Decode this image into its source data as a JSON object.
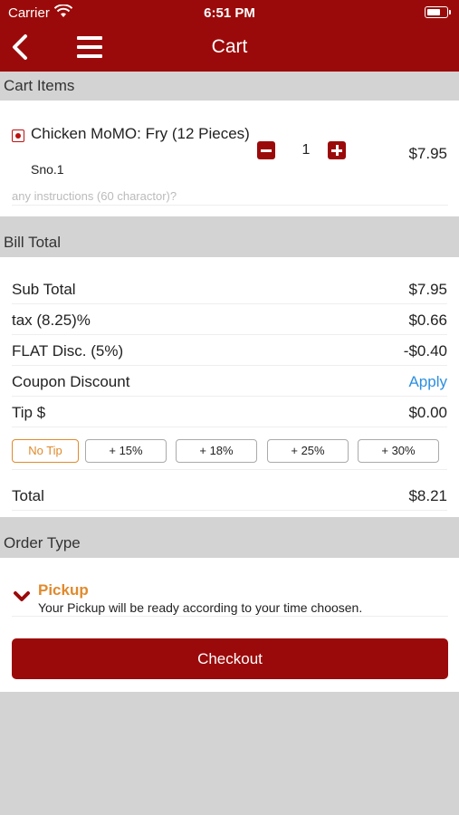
{
  "status_bar": {
    "carrier": "Carrier",
    "time": "6:51 PM"
  },
  "nav": {
    "title": "Cart"
  },
  "sections": {
    "cart_items": "Cart Items",
    "bill_total": "Bill Total",
    "order_type": "Order Type"
  },
  "cart": {
    "items": [
      {
        "name": "Chicken MoMO: Fry (12 Pieces)",
        "sno": "Sno.1",
        "quantity": "1",
        "price": "$7.95",
        "instructions_placeholder": "any instructions (60 charactor)?"
      }
    ]
  },
  "bill": {
    "sub_total_label": "Sub Total",
    "sub_total": "$7.95",
    "tax_label": "tax (8.25)%",
    "tax": "$0.66",
    "flat_disc_label": "FLAT Disc. (5%)",
    "flat_disc": "-$0.40",
    "coupon_label": "Coupon Discount",
    "coupon_action": "Apply",
    "tip_label": "Tip $",
    "tip": "$0.00",
    "tip_options": [
      "No Tip",
      "+ 15%",
      "+ 18%",
      "+ 25%",
      "+ 30%"
    ],
    "total_label": "Total",
    "total": "$8.21"
  },
  "order": {
    "type": "Pickup",
    "description": "Your Pickup will be ready according to your time choosen."
  },
  "checkout_label": "Checkout",
  "colors": {
    "brand": "#9b0a0a",
    "accent": "#e08a2c",
    "link": "#2d8fe0"
  }
}
